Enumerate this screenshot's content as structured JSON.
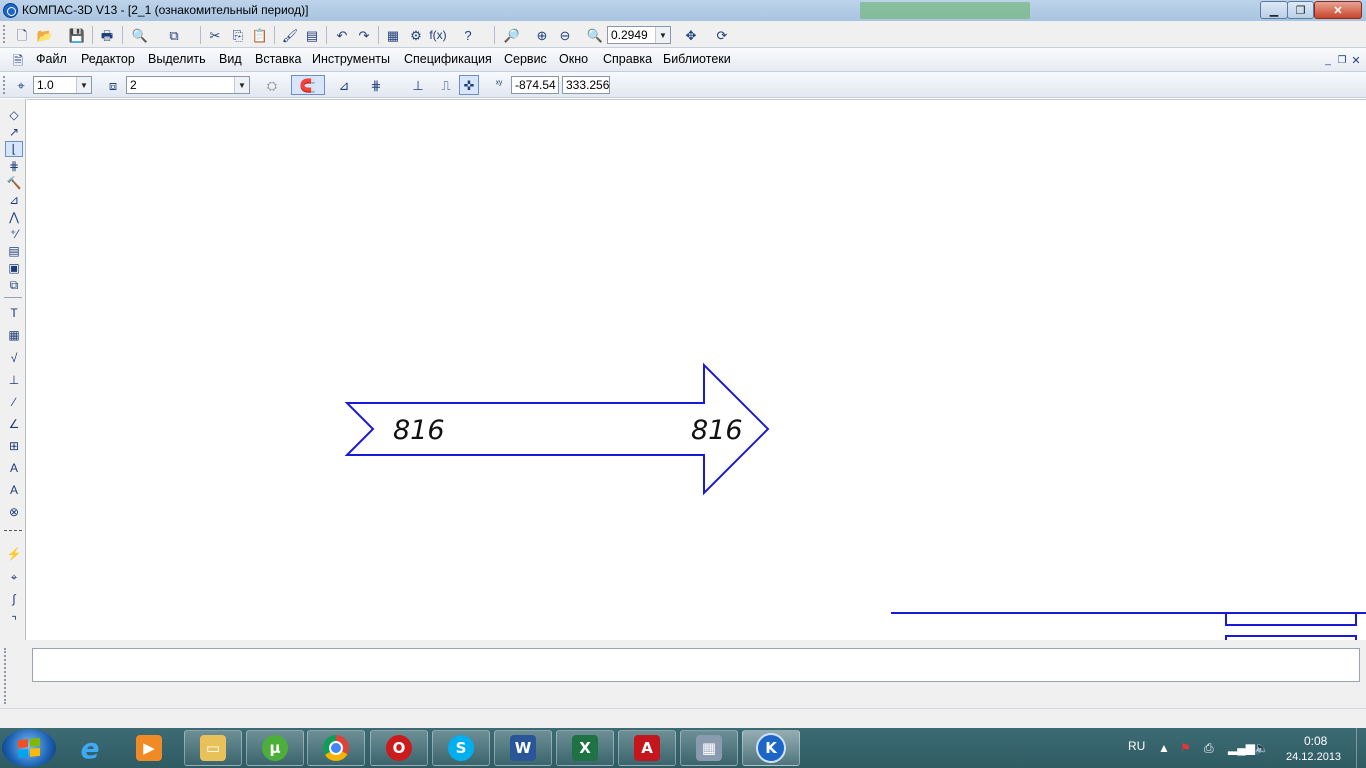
{
  "window": {
    "title": "КОМПАС-3D V13 - [2_1 (ознакомительный период)]"
  },
  "menu": {
    "items": [
      {
        "label": "Файл"
      },
      {
        "label": "Редактор"
      },
      {
        "label": "Выделить"
      },
      {
        "label": "Вид"
      },
      {
        "label": "Вставка"
      },
      {
        "label": "Инструменты"
      },
      {
        "label": "Спецификация"
      },
      {
        "label": "Сервис"
      },
      {
        "label": "Окно"
      },
      {
        "label": "Справка"
      },
      {
        "label": "Библиотеки"
      }
    ]
  },
  "toolbar": {
    "zoom_value": "0.2949",
    "step_value": "1.0",
    "layer_value": "2",
    "coord_x": "-874.54",
    "coord_y": "333.256"
  },
  "canvas": {
    "label_left": "816",
    "label_right": "816",
    "line_color": "#1a1ad6"
  },
  "taskbar": {
    "lang": "RU",
    "time": "0:08",
    "date": "24.12.2013"
  }
}
